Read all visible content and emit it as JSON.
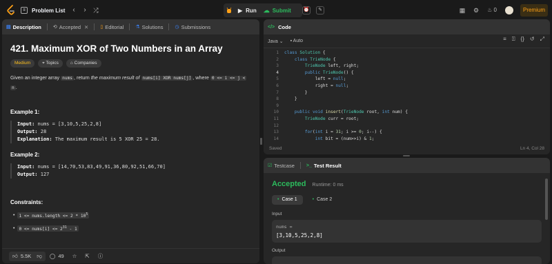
{
  "topbar": {
    "problem_list": "Problem List",
    "run": "Run",
    "submit": "Submit",
    "streak": "0",
    "premium": "Premium"
  },
  "colors": {
    "accent": "#ffa116",
    "green": "#2cbb5d",
    "medium": "#ffc01e"
  },
  "left_tabs": [
    {
      "label": "Description",
      "icon": "description-icon"
    },
    {
      "label": "Accepted",
      "icon": "history-icon"
    },
    {
      "label": "Editorial",
      "icon": "book-icon"
    },
    {
      "label": "Solutions",
      "icon": "flask-icon"
    },
    {
      "label": "Submissions",
      "icon": "clock-icon"
    }
  ],
  "problem": {
    "title": "421. Maximum XOR of Two Numbers in an Array",
    "difficulty": "Medium",
    "topics": "Topics",
    "companies": "Companies",
    "stmt_a": "Given an integer array",
    "stmt_code1": "nums",
    "stmt_b": ", return",
    "stmt_em": "the maximum result of",
    "stmt_code2": "nums[i] XOR nums[j]",
    "stmt_c": ", where",
    "stmt_code3": "0 <= i <= j <",
    "stmt_code4": "n",
    "stmt_d": "."
  },
  "examples": [
    {
      "heading": "Example 1:",
      "input_label": "Input:",
      "input": "nums = [3,10,5,25,2,8]",
      "output_label": "Output:",
      "output": "28",
      "expl_label": "Explanation:",
      "expl": "The maximum result is 5 XOR 25 = 28."
    },
    {
      "heading": "Example 2:",
      "input_label": "Input:",
      "input": "nums = [14,70,53,83,49,91,36,80,92,51,66,70]",
      "output_label": "Output:",
      "output": "127"
    }
  ],
  "constraints": {
    "heading": "Constraints:",
    "c1_base": "1 <= nums.length <= 2 * 10",
    "c1_sup": "5",
    "c2_base": "0 <= nums[i] <= 2",
    "c2_sup": "31",
    "c2_tail": " - 1"
  },
  "bottom": {
    "likes": "5.5K",
    "comments": "49"
  },
  "code_panel": {
    "title": "Code",
    "language": "Java",
    "mode": "Auto",
    "status": "Saved",
    "cursor": "Ln 4, Col 28",
    "line_numbers": [
      "1",
      "2",
      "3",
      "4",
      "5",
      "6",
      "7",
      "8",
      "9",
      "10",
      "11",
      "12",
      "13",
      "14",
      "15"
    ],
    "lines": [
      "class Solution {",
      "    class TrieNode {",
      "        TrieNode left, right;",
      "        public TrieNode() {",
      "            left = null;",
      "            right = null;",
      "        }",
      "    }",
      "",
      "    public void insert(TrieNode root, int num) {",
      "        TrieNode curr = root;",
      "",
      "        for(int i = 31; i >= 0; i--) {",
      "            int bit = (num>>i) & 1;",
      "            if(bit == 0) {"
    ]
  },
  "result_panel": {
    "tab1": "Testcase",
    "tab2": "Test Result",
    "status": "Accepted",
    "runtime": "Runtime: 0 ms",
    "case1": "Case 1",
    "case2": "Case 2",
    "input_label": "Input",
    "var_name": "nums =",
    "var_value": "[3,10,5,25,2,8]",
    "output_label": "Output"
  }
}
